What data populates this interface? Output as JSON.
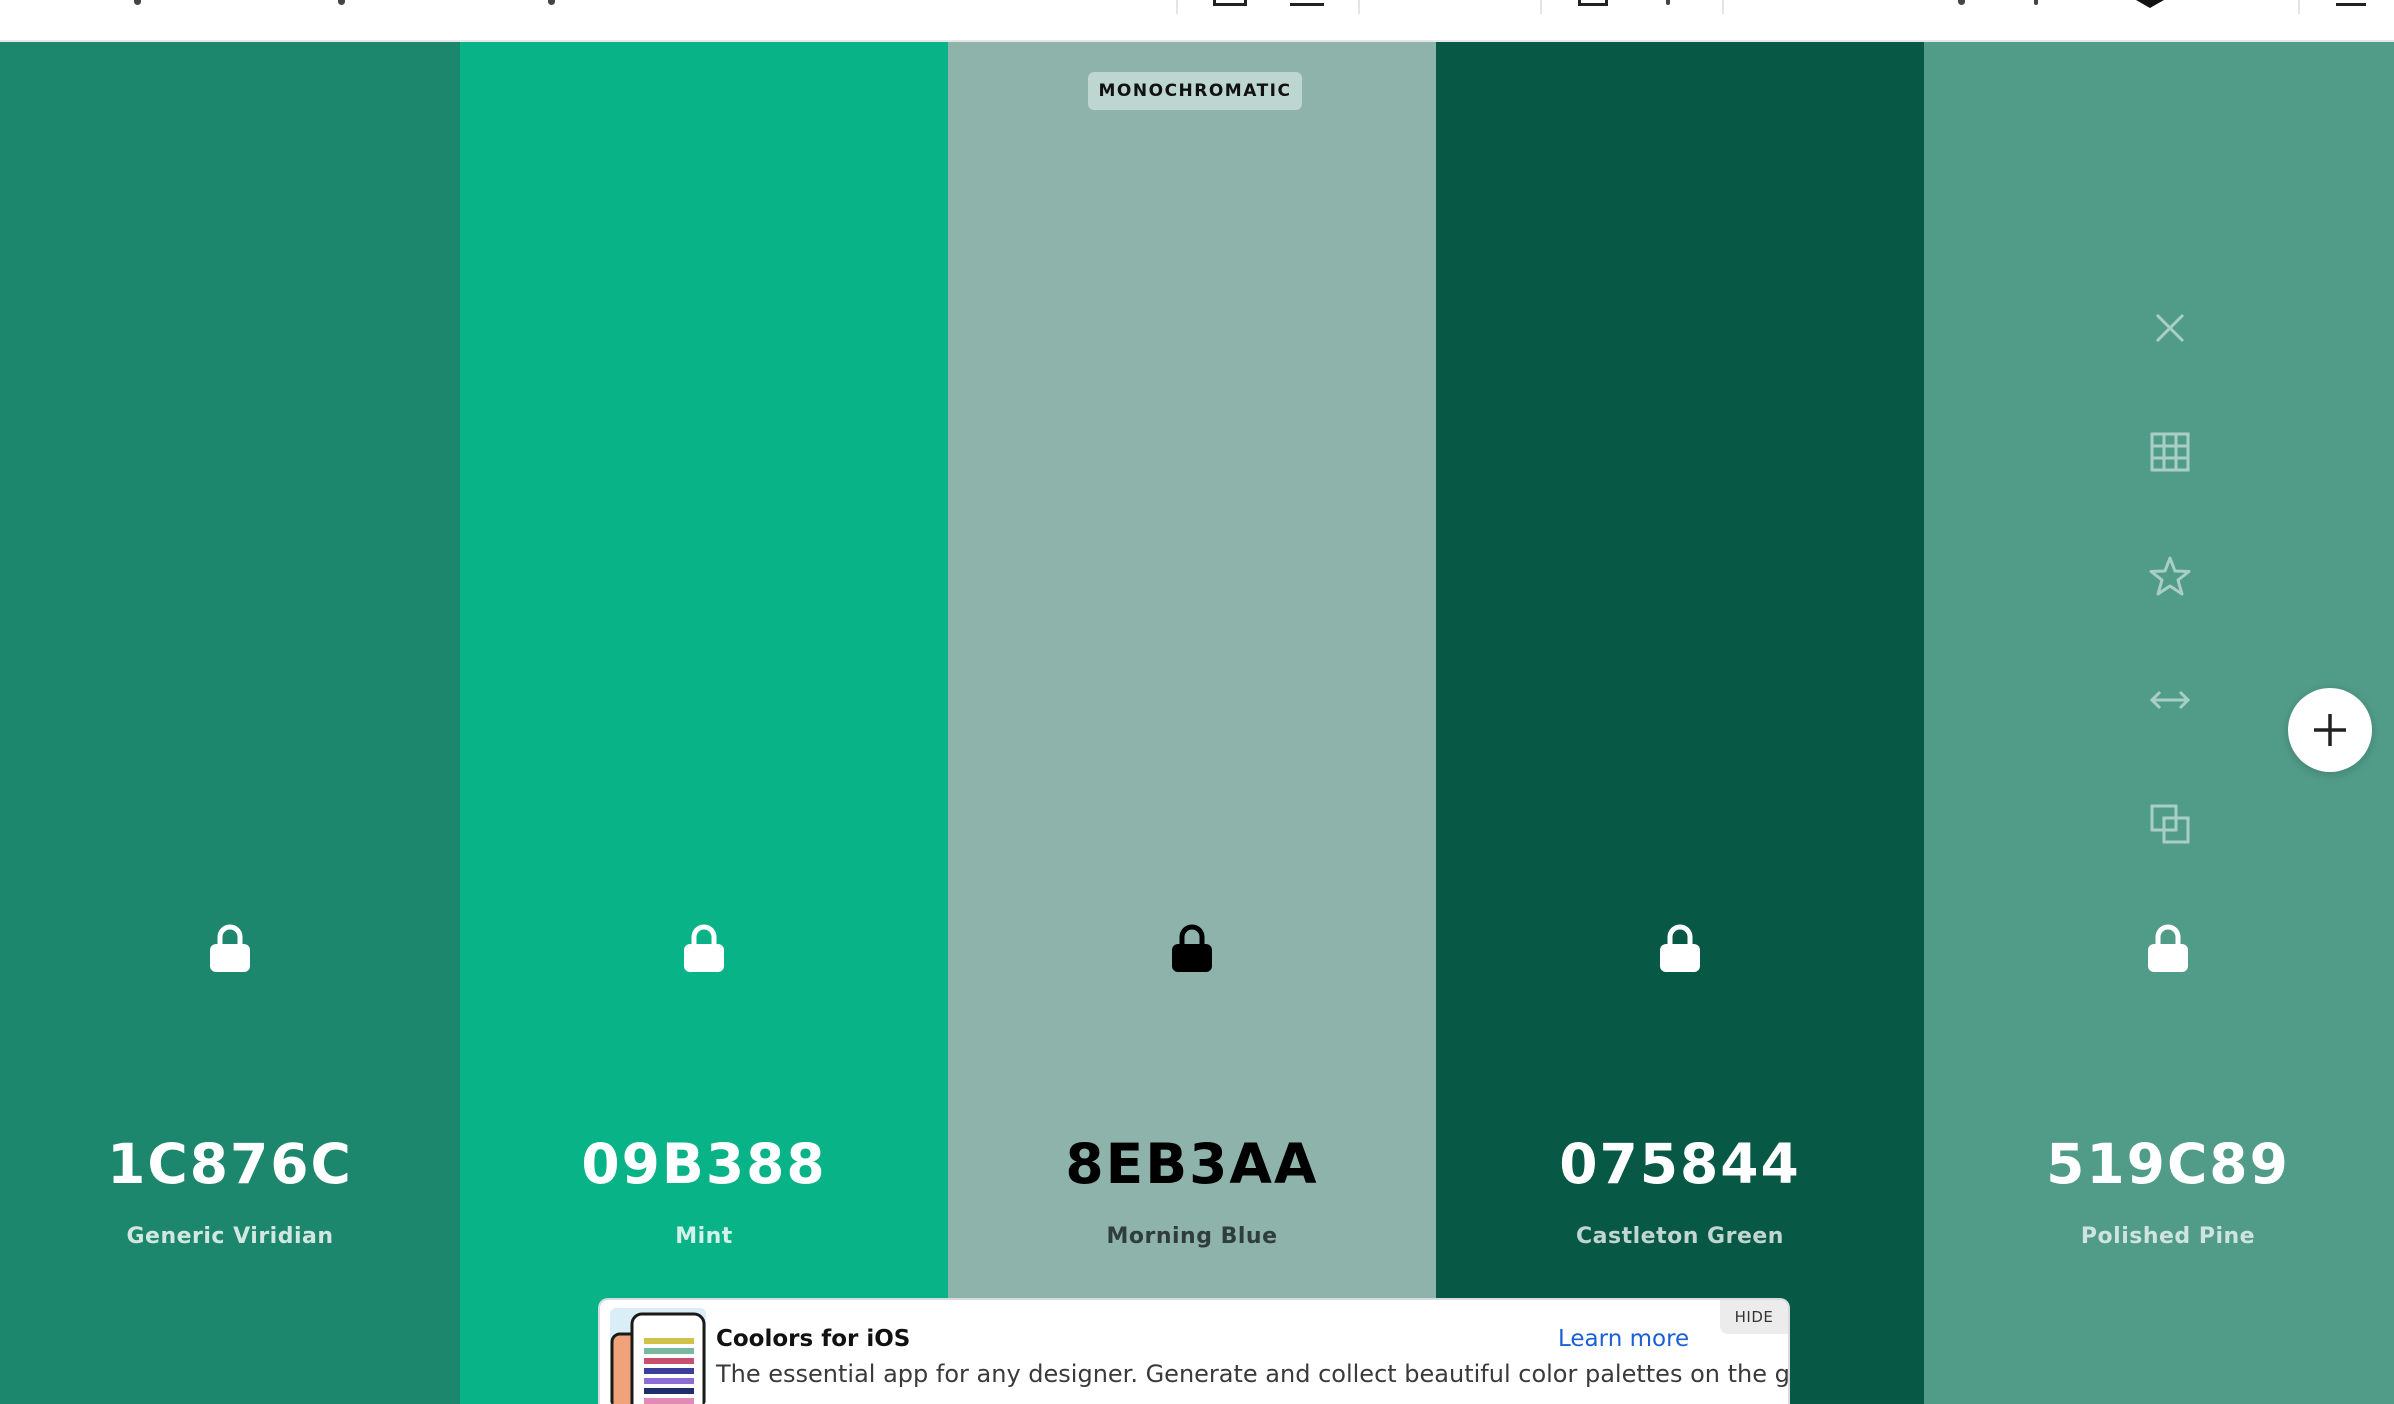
{
  "palette": {
    "badge": "MONOCHROMATIC",
    "colors": [
      {
        "hex": "1C876C",
        "name": "Generic Viridian",
        "bg": "#1c876c",
        "text_color": "#ffffff",
        "name_color": "#d2e7e1",
        "lock_color": "#ffffff"
      },
      {
        "hex": "09B388",
        "name": "Mint",
        "bg": "#09b388",
        "text_color": "#ffffff",
        "name_color": "#d5f2ea",
        "lock_color": "#ffffff"
      },
      {
        "hex": "8EB3AA",
        "name": "Morning Blue",
        "bg": "#8eb3aa",
        "text_color": "#000000",
        "name_color": "#2f3e3a",
        "lock_color": "#000000"
      },
      {
        "hex": "075844",
        "name": "Castleton Green",
        "bg": "#075844",
        "text_color": "#ffffff",
        "name_color": "#c2d6d1",
        "lock_color": "#ffffff"
      },
      {
        "hex": "519C89",
        "name": "Polished Pine",
        "bg": "#519c89",
        "text_color": "#ffffff",
        "name_color": "#cfe4de",
        "lock_color": "#ffffff"
      }
    ]
  },
  "tools": [
    {
      "icon": "close-icon"
    },
    {
      "icon": "shades-grid-icon"
    },
    {
      "icon": "star-icon"
    },
    {
      "icon": "drag-arrows-icon"
    },
    {
      "icon": "copy-icon"
    }
  ],
  "ad": {
    "title": "Coolors for iOS",
    "description": "The essential app for any designer. Generate and collect beautiful color palettes on the go.",
    "link": "Learn more",
    "hide": "HIDE"
  }
}
